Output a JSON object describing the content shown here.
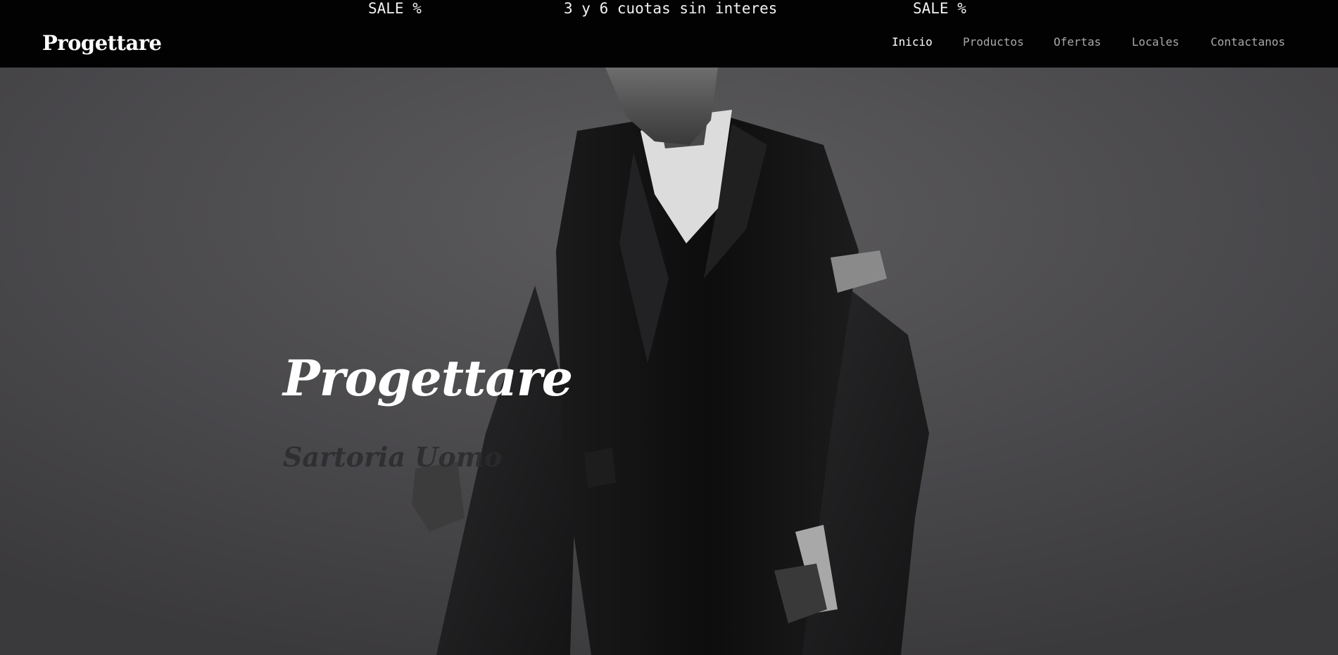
{
  "announcement": {
    "items": [
      "SALE %",
      "3 y 6 cuotas sin interes",
      "SALE %"
    ]
  },
  "header": {
    "logo": "Progettare",
    "nav": [
      {
        "label": "Inicio",
        "active": true
      },
      {
        "label": "Productos",
        "active": false
      },
      {
        "label": "Ofertas",
        "active": false
      },
      {
        "label": "Locales",
        "active": false
      },
      {
        "label": "Contactanos",
        "active": false
      }
    ]
  },
  "hero": {
    "title": "Progettare",
    "subtitle": "Sartoria Uomo"
  },
  "colors": {
    "header_bg": "#020202",
    "nav_active": "#ffffff",
    "nav_inactive": "#a9a9a9",
    "hero_bg": "#4a494b"
  }
}
